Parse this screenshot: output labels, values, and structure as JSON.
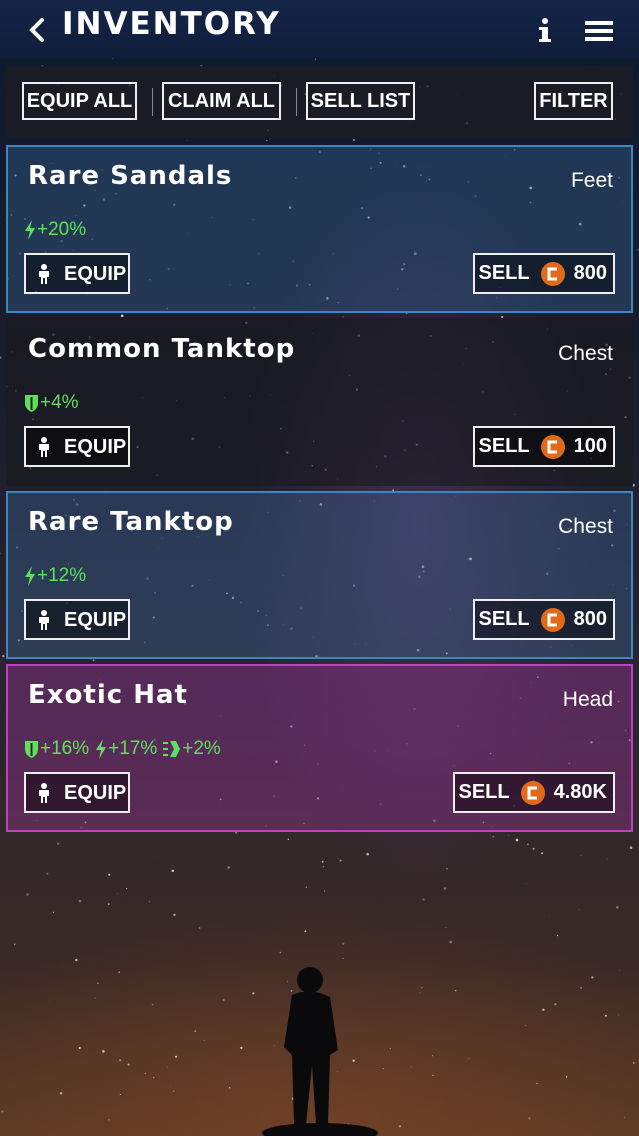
{
  "header": {
    "title": "INVENTORY"
  },
  "toolbar": {
    "equip_all": "EQUIP ALL",
    "claim_all": "CLAIM ALL",
    "sell_list": "SELL LIST",
    "filter": "FILTER"
  },
  "items": [
    {
      "name": "Rare Sandals",
      "slot": "Feet",
      "rarity": "rare",
      "stats": [
        {
          "icon": "energy-bolt-icon",
          "value": "+20%"
        }
      ],
      "equip_label": "EQUIP",
      "sell_label": "SELL",
      "price": "800"
    },
    {
      "name": "Common Tanktop",
      "slot": "Chest",
      "rarity": "common",
      "stats": [
        {
          "icon": "shield-icon",
          "value": "+4%"
        }
      ],
      "equip_label": "EQUIP",
      "sell_label": "SELL",
      "price": "100"
    },
    {
      "name": "Rare Tanktop",
      "slot": "Chest",
      "rarity": "rare",
      "stats": [
        {
          "icon": "energy-bolt-icon",
          "value": "+12%"
        }
      ],
      "equip_label": "EQUIP",
      "sell_label": "SELL",
      "price": "800"
    },
    {
      "name": "Exotic Hat",
      "slot": "Head",
      "rarity": "exotic",
      "stats": [
        {
          "icon": "shield-icon",
          "value": "+16%"
        },
        {
          "icon": "energy-bolt-icon",
          "value": "+17%"
        },
        {
          "icon": "speed-icon",
          "value": "+2%"
        }
      ],
      "equip_label": "EQUIP",
      "sell_label": "SELL",
      "price": "4.80K"
    }
  ],
  "colors": {
    "rare_border": "#3e86c0",
    "exotic_border": "#c040c0",
    "stat_green": "#5fe05a",
    "coin_orange": "#e06a1a",
    "header_bg": "#15264a"
  }
}
